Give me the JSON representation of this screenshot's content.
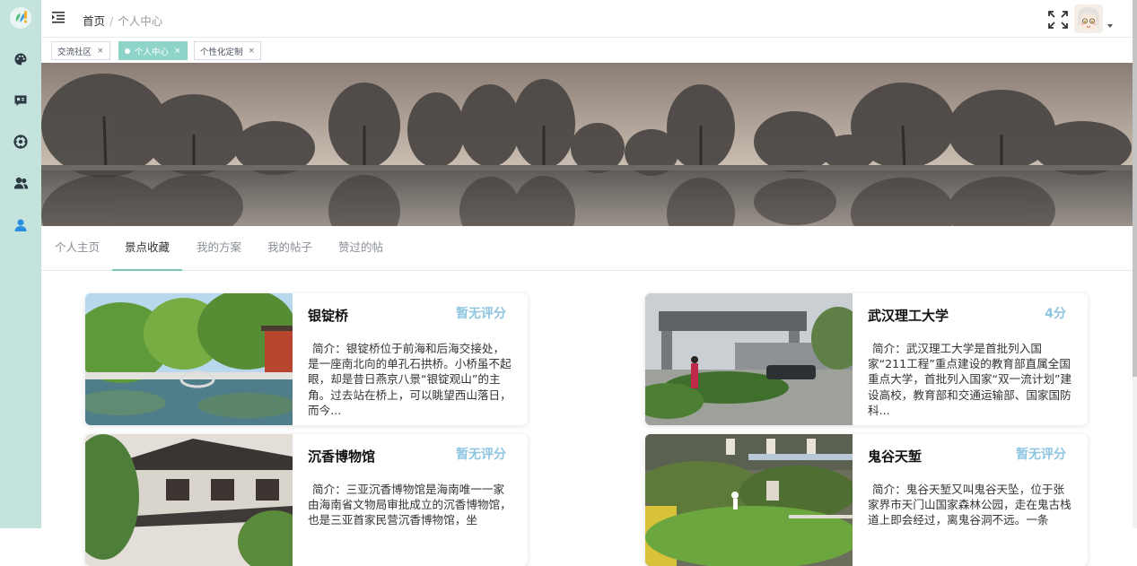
{
  "breadcrumb": {
    "home": "首页",
    "separator": "/",
    "current": "个人中心"
  },
  "tags": [
    {
      "label": "交流社区",
      "close": "×",
      "active": false
    },
    {
      "label": "个人中心",
      "close": "×",
      "active": true
    },
    {
      "label": "个性化定制",
      "close": "×",
      "active": false
    }
  ],
  "sidebar": {
    "logo_icon": "logo-icon",
    "items": [
      {
        "icon": "palette-icon"
      },
      {
        "icon": "chat-icon"
      },
      {
        "icon": "compass-icon"
      },
      {
        "icon": "users-icon"
      },
      {
        "icon": "user-icon",
        "active": true
      }
    ]
  },
  "profile_tabs": [
    {
      "label": "个人主页",
      "active": false
    },
    {
      "label": "景点收藏",
      "active": true
    },
    {
      "label": "我的方案",
      "active": false
    },
    {
      "label": "我的帖子",
      "active": false
    },
    {
      "label": "赞过的帖",
      "active": false
    }
  ],
  "cards": [
    {
      "title": "银锭桥",
      "score": "暂无评分",
      "desc": "简介：银锭桥位于前海和后海交接处，是一座南北向的单孔石拱桥。小桥虽不起眼，却是昔日燕京八景“银锭观山”的主角。过去站在桥上，可以眺望西山落日，而今..."
    },
    {
      "title": "武汉理工大学",
      "score": "4分",
      "desc": "简介：武汉理工大学是首批列入国家“211工程”重点建设的教育部直属全国重点大学，首批列入国家“双一流计划”建设高校，教育部和交通运输部、国家国防科..."
    },
    {
      "title": "沉香博物馆",
      "score": "暂无评分",
      "desc": "简介：三亚沉香博物馆是海南唯一一家由海南省文物局审批成立的沉香博物馆，也是三亚首家民营沉香博物馆，坐"
    },
    {
      "title": "鬼谷天堑",
      "score": "暂无评分",
      "desc": "简介：鬼谷天堑又叫鬼谷天坠，位于张家界市天门山国家森林公园，走在鬼古栈道上即会经过，离鬼谷洞不远。一条"
    }
  ],
  "colors": {
    "sidebar": "#c4e3dd",
    "accent": "#8fd4c8",
    "score": "#8ec5e0"
  }
}
